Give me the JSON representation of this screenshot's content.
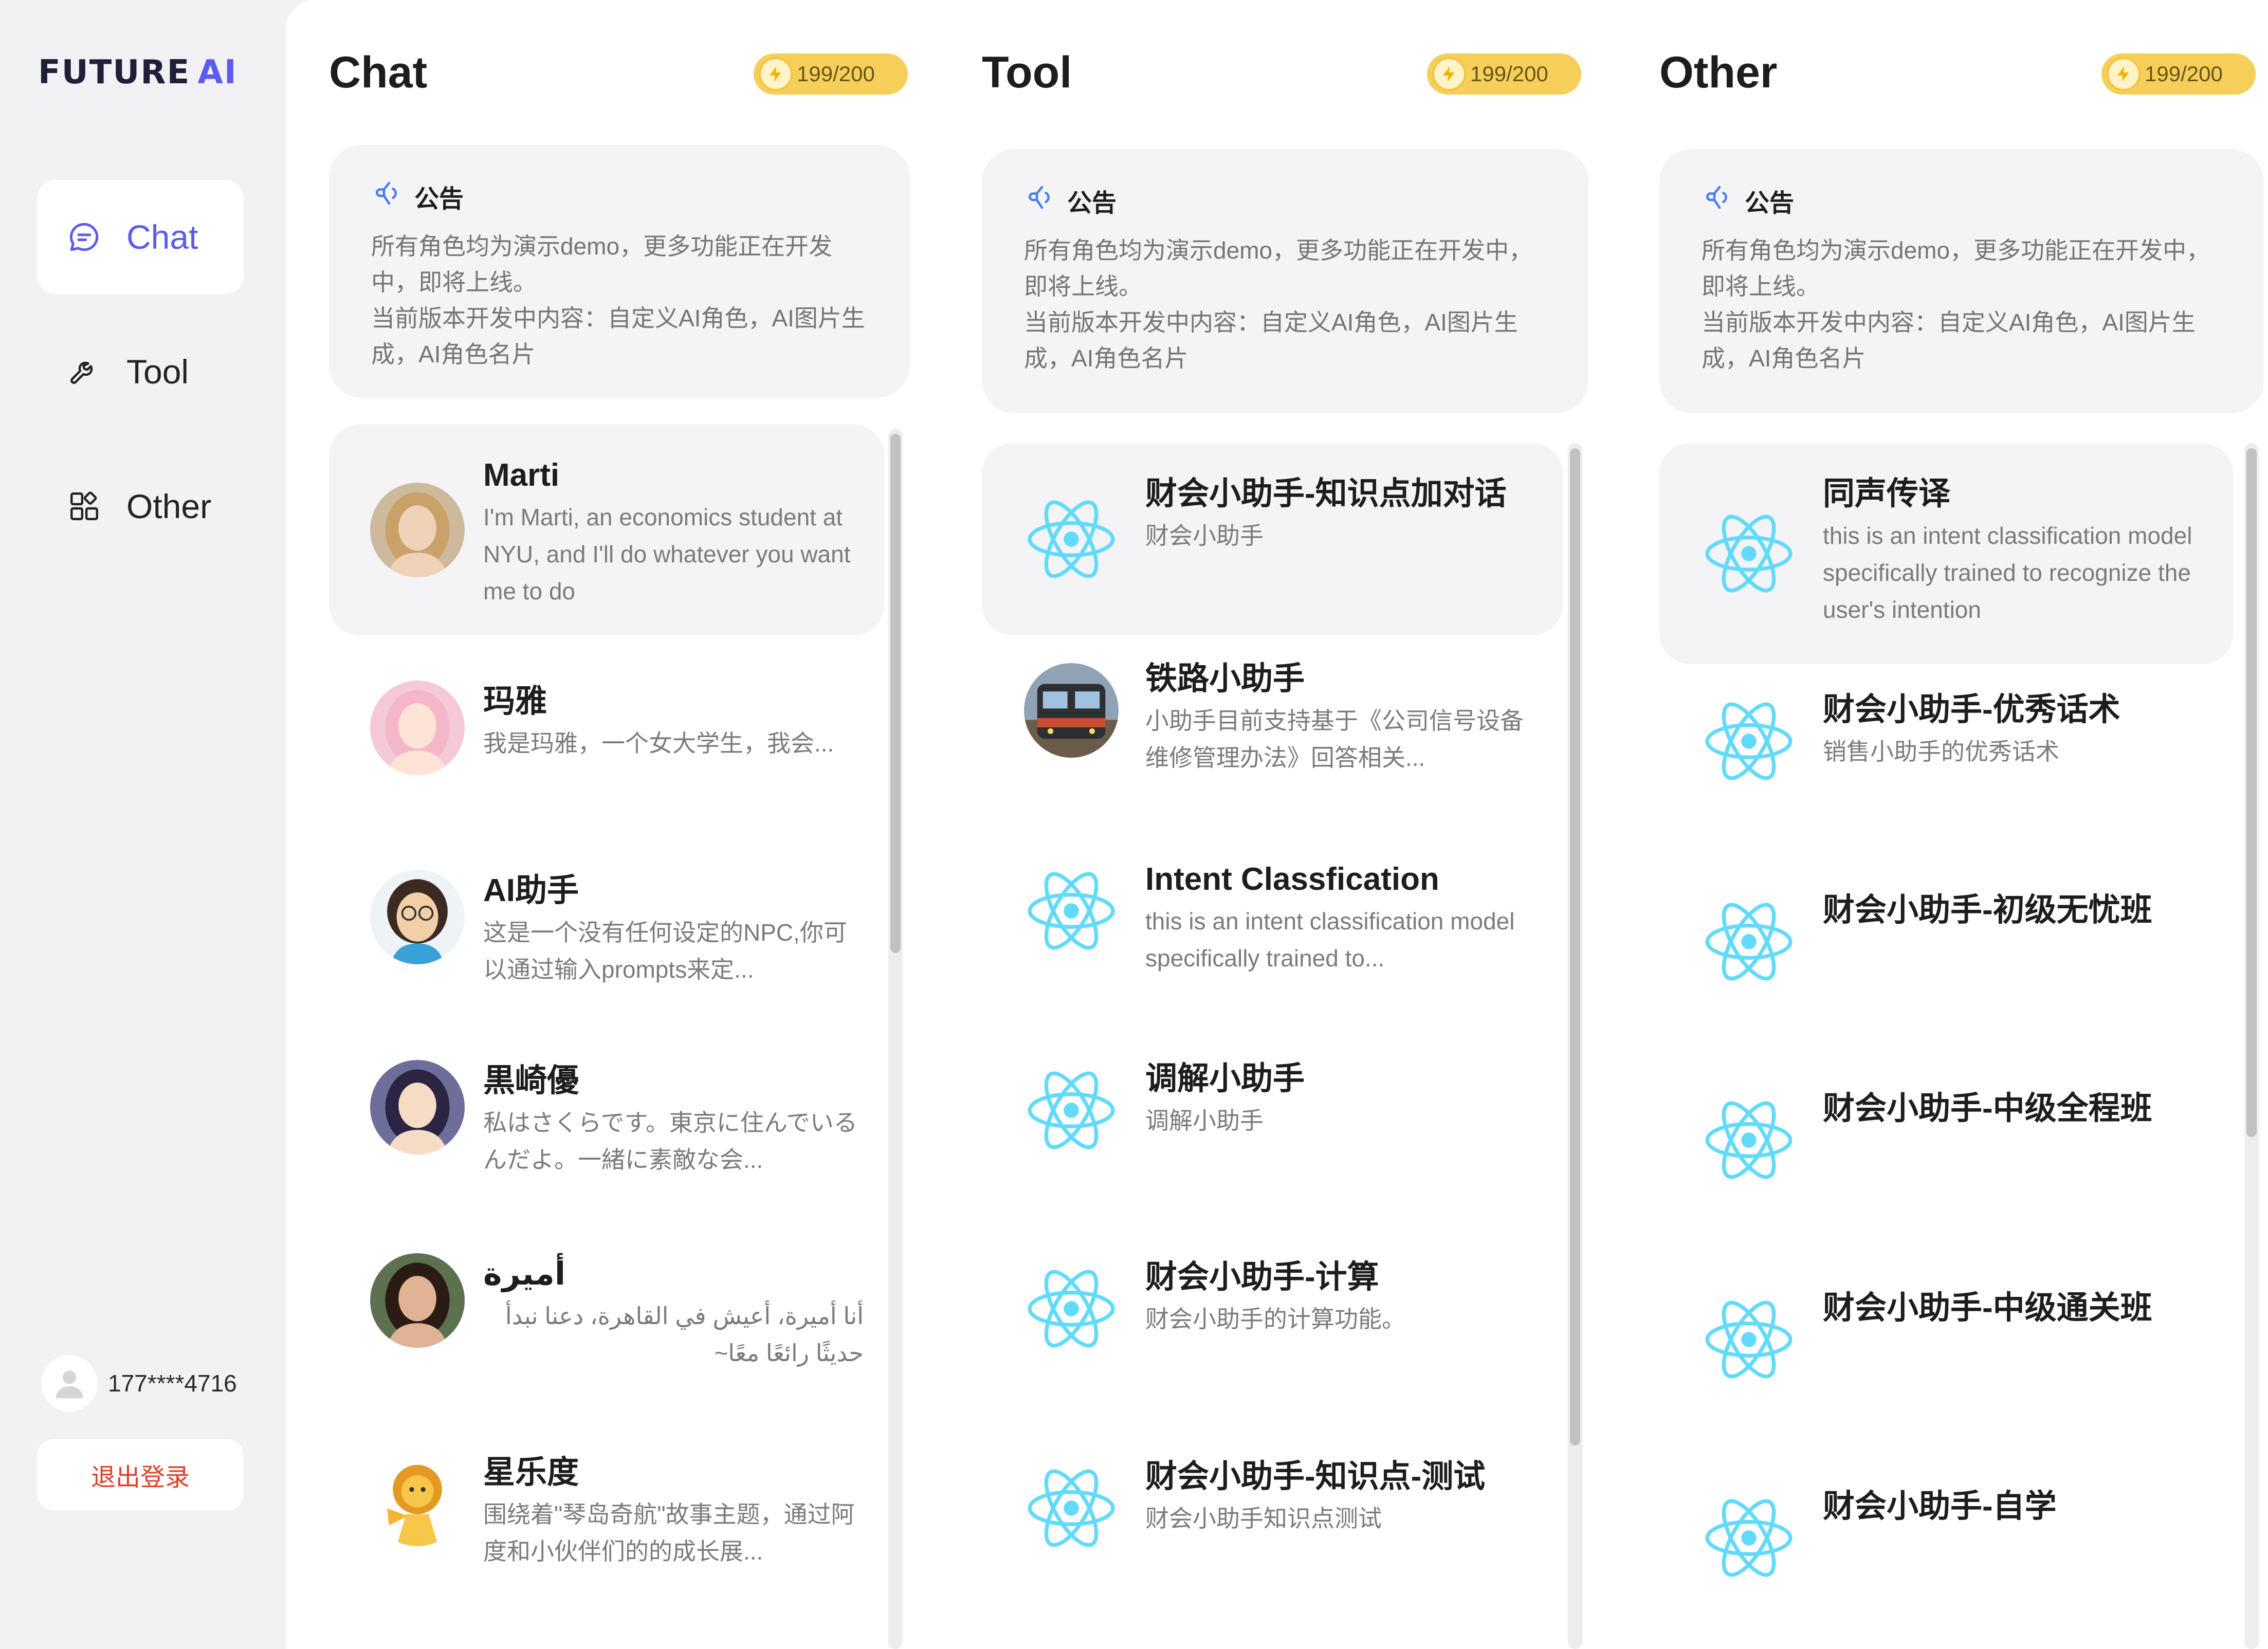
{
  "brand": {
    "part1": "FUTURE",
    "part2": "AI",
    "accent": "#5b5bf0"
  },
  "nav": [
    {
      "label": "Chat",
      "icon": "chat-bubble-icon",
      "active": true
    },
    {
      "label": "Tool",
      "icon": "wrench-icon",
      "active": false
    },
    {
      "label": "Other",
      "icon": "apps-grid-icon",
      "active": false
    }
  ],
  "user": {
    "phone": "177****4716",
    "logout": "退出登录"
  },
  "notice": {
    "title": "公告",
    "line1": "所有角色均为演示demo，更多功能正在开发中，即将上线。",
    "line2": "当前版本开发中内容：自定义AI角色，AI图片生成，AI角色名片"
  },
  "columns": [
    {
      "title": "Chat",
      "quota": "199/200",
      "items": [
        {
          "name": "Marti",
          "desc": "I'm Marti, an economics student at NYU, and I'll do whatever you want me to do",
          "avatar": "photo-woman-blonde"
        },
        {
          "name": "玛雅",
          "desc": "我是玛雅，一个女大学生，我会...",
          "avatar": "anime-girl-pink"
        },
        {
          "name": "AI助手",
          "desc": "这是一个没有任何设定的NPC,你可以通过输入prompts来定...",
          "avatar": "cartoon-girl-glasses"
        },
        {
          "name": "黒崎優",
          "desc": "私はさくらです。東京に住んでいるんだよ。一緒に素敵な会...",
          "avatar": "anime-warrior"
        },
        {
          "name": "أميرة",
          "desc": "أنا أميرة، أعيش في القاهرة، دعنا نبدأ حديثًا رائعًا معًا~",
          "avatar": "photo-woman-dark-hair"
        },
        {
          "name": "星乐度",
          "desc": "围绕着\"琴岛奇航\"故事主题，通过阿度和小伙伴们的的成长展...",
          "avatar": "lion-mascot"
        }
      ]
    },
    {
      "title": "Tool",
      "quota": "199/200",
      "items": [
        {
          "name": "财会小助手-知识点加对话",
          "desc": "财会小助手",
          "avatar": "react-atom"
        },
        {
          "name": "铁路小助手",
          "desc": "小助手目前支持基于《公司信号设备维修管理办法》回答相关...",
          "avatar": "train-photo"
        },
        {
          "name": "Intent Classfication",
          "desc": "this is an intent classification model specifically trained to...",
          "avatar": "react-atom"
        },
        {
          "name": "调解小助手",
          "desc": "调解小助手",
          "avatar": "react-atom"
        },
        {
          "name": "财会小助手-计算",
          "desc": "财会小助手的计算功能。",
          "avatar": "react-atom"
        },
        {
          "name": "财会小助手-知识点-测试",
          "desc": "财会小助手知识点测试",
          "avatar": "react-atom"
        }
      ]
    },
    {
      "title": "Other",
      "quota": "199/200",
      "items": [
        {
          "name": "同声传译",
          "desc": "this is an intent classification model specifically trained to recognize the user's intention",
          "avatar": "react-atom"
        },
        {
          "name": "财会小助手-优秀话术",
          "desc": "销售小助手的优秀话术",
          "avatar": "react-atom"
        },
        {
          "name": "财会小助手-初级无忧班",
          "desc": "",
          "avatar": "react-atom"
        },
        {
          "name": "财会小助手-中级全程班",
          "desc": "",
          "avatar": "react-atom"
        },
        {
          "name": "财会小助手-中级通关班",
          "desc": "",
          "avatar": "react-atom"
        },
        {
          "name": "财会小助手-自学",
          "desc": "",
          "avatar": "react-atom"
        }
      ]
    }
  ]
}
